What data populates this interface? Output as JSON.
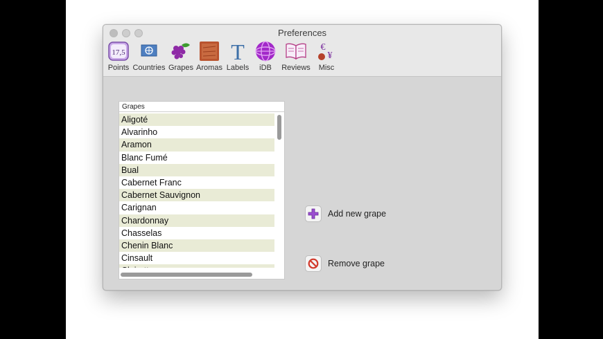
{
  "window": {
    "title": "Preferences"
  },
  "toolbar": {
    "items": [
      {
        "label": "Points",
        "icon": "points-icon",
        "badge": "17,5"
      },
      {
        "label": "Countries",
        "icon": "countries-icon"
      },
      {
        "label": "Grapes",
        "icon": "grapes-icon"
      },
      {
        "label": "Aromas",
        "icon": "aromas-icon"
      },
      {
        "label": "Labels",
        "icon": "labels-icon",
        "glyph": "T"
      },
      {
        "label": "iDB",
        "icon": "idb-icon"
      },
      {
        "label": "Reviews",
        "icon": "reviews-icon"
      },
      {
        "label": "Misc",
        "icon": "misc-icon",
        "glyph": "€¥"
      }
    ]
  },
  "grapes": {
    "header": "Grapes",
    "items": [
      "Aligoté",
      "Alvarinho",
      "Aramon",
      "Blanc Fumé",
      "Bual",
      "Cabernet Franc",
      "Cabernet Sauvignon",
      "Carignan",
      "Chardonnay",
      "Chasselas",
      "Chenin Blanc",
      "Cinsault",
      "Clairette"
    ]
  },
  "actions": {
    "add_label": "Add new grape",
    "remove_label": "Remove grape"
  },
  "colors": {
    "row_stripe": "#e9ebd6",
    "window_bg": "#d6d6d6",
    "add_icon": "#9b4fd0",
    "remove_icon": "#d23a2c"
  }
}
